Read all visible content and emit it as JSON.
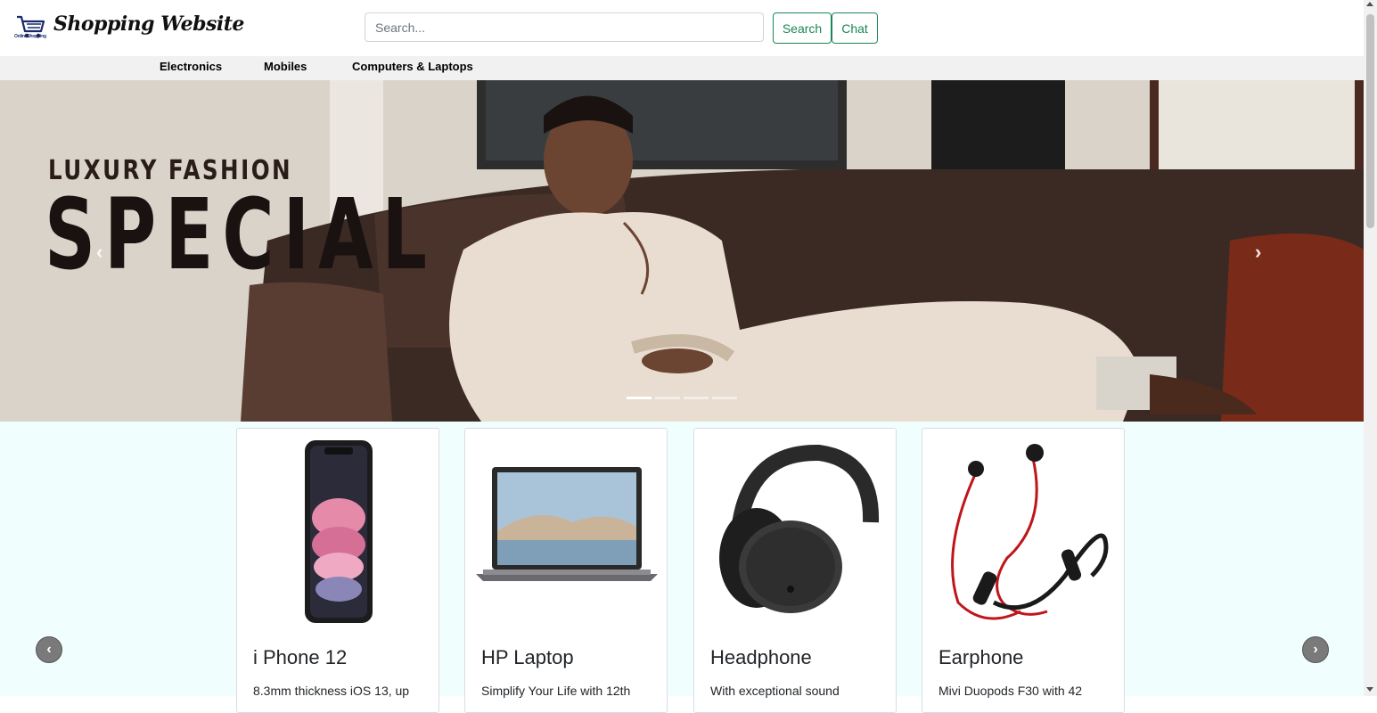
{
  "header": {
    "brand": "Shopping Website",
    "logo_text": "OnlineShopping",
    "search_placeholder": "Search...",
    "search_button": "Search",
    "chat_button": "Chat"
  },
  "nav": {
    "items": [
      {
        "label": "Electronics"
      },
      {
        "label": "Mobiles"
      },
      {
        "label": "Computers & Laptops"
      }
    ]
  },
  "hero": {
    "subtitle": "LUXURY FASHION",
    "title": "SPECIAL",
    "prev_icon": "‹",
    "next_icon": "›",
    "slides": 4,
    "active_slide": 1
  },
  "products": {
    "prev_icon": "‹",
    "next_icon": "›",
    "items": [
      {
        "name": "i Phone 12",
        "desc": "8.3mm thickness iOS 13, up",
        "icon": "smartphone-image"
      },
      {
        "name": "HP Laptop",
        "desc": "Simplify Your Life with 12th",
        "icon": "laptop-image"
      },
      {
        "name": "Headphone",
        "desc": "With exceptional sound",
        "icon": "headphone-image"
      },
      {
        "name": "Earphone",
        "desc": "Mivi Duopods F30 with 42",
        "icon": "earphone-image"
      }
    ]
  },
  "colors": {
    "accent": "#198754",
    "nav_bg": "#f1f1f1",
    "products_bg": "#f0fffe"
  }
}
